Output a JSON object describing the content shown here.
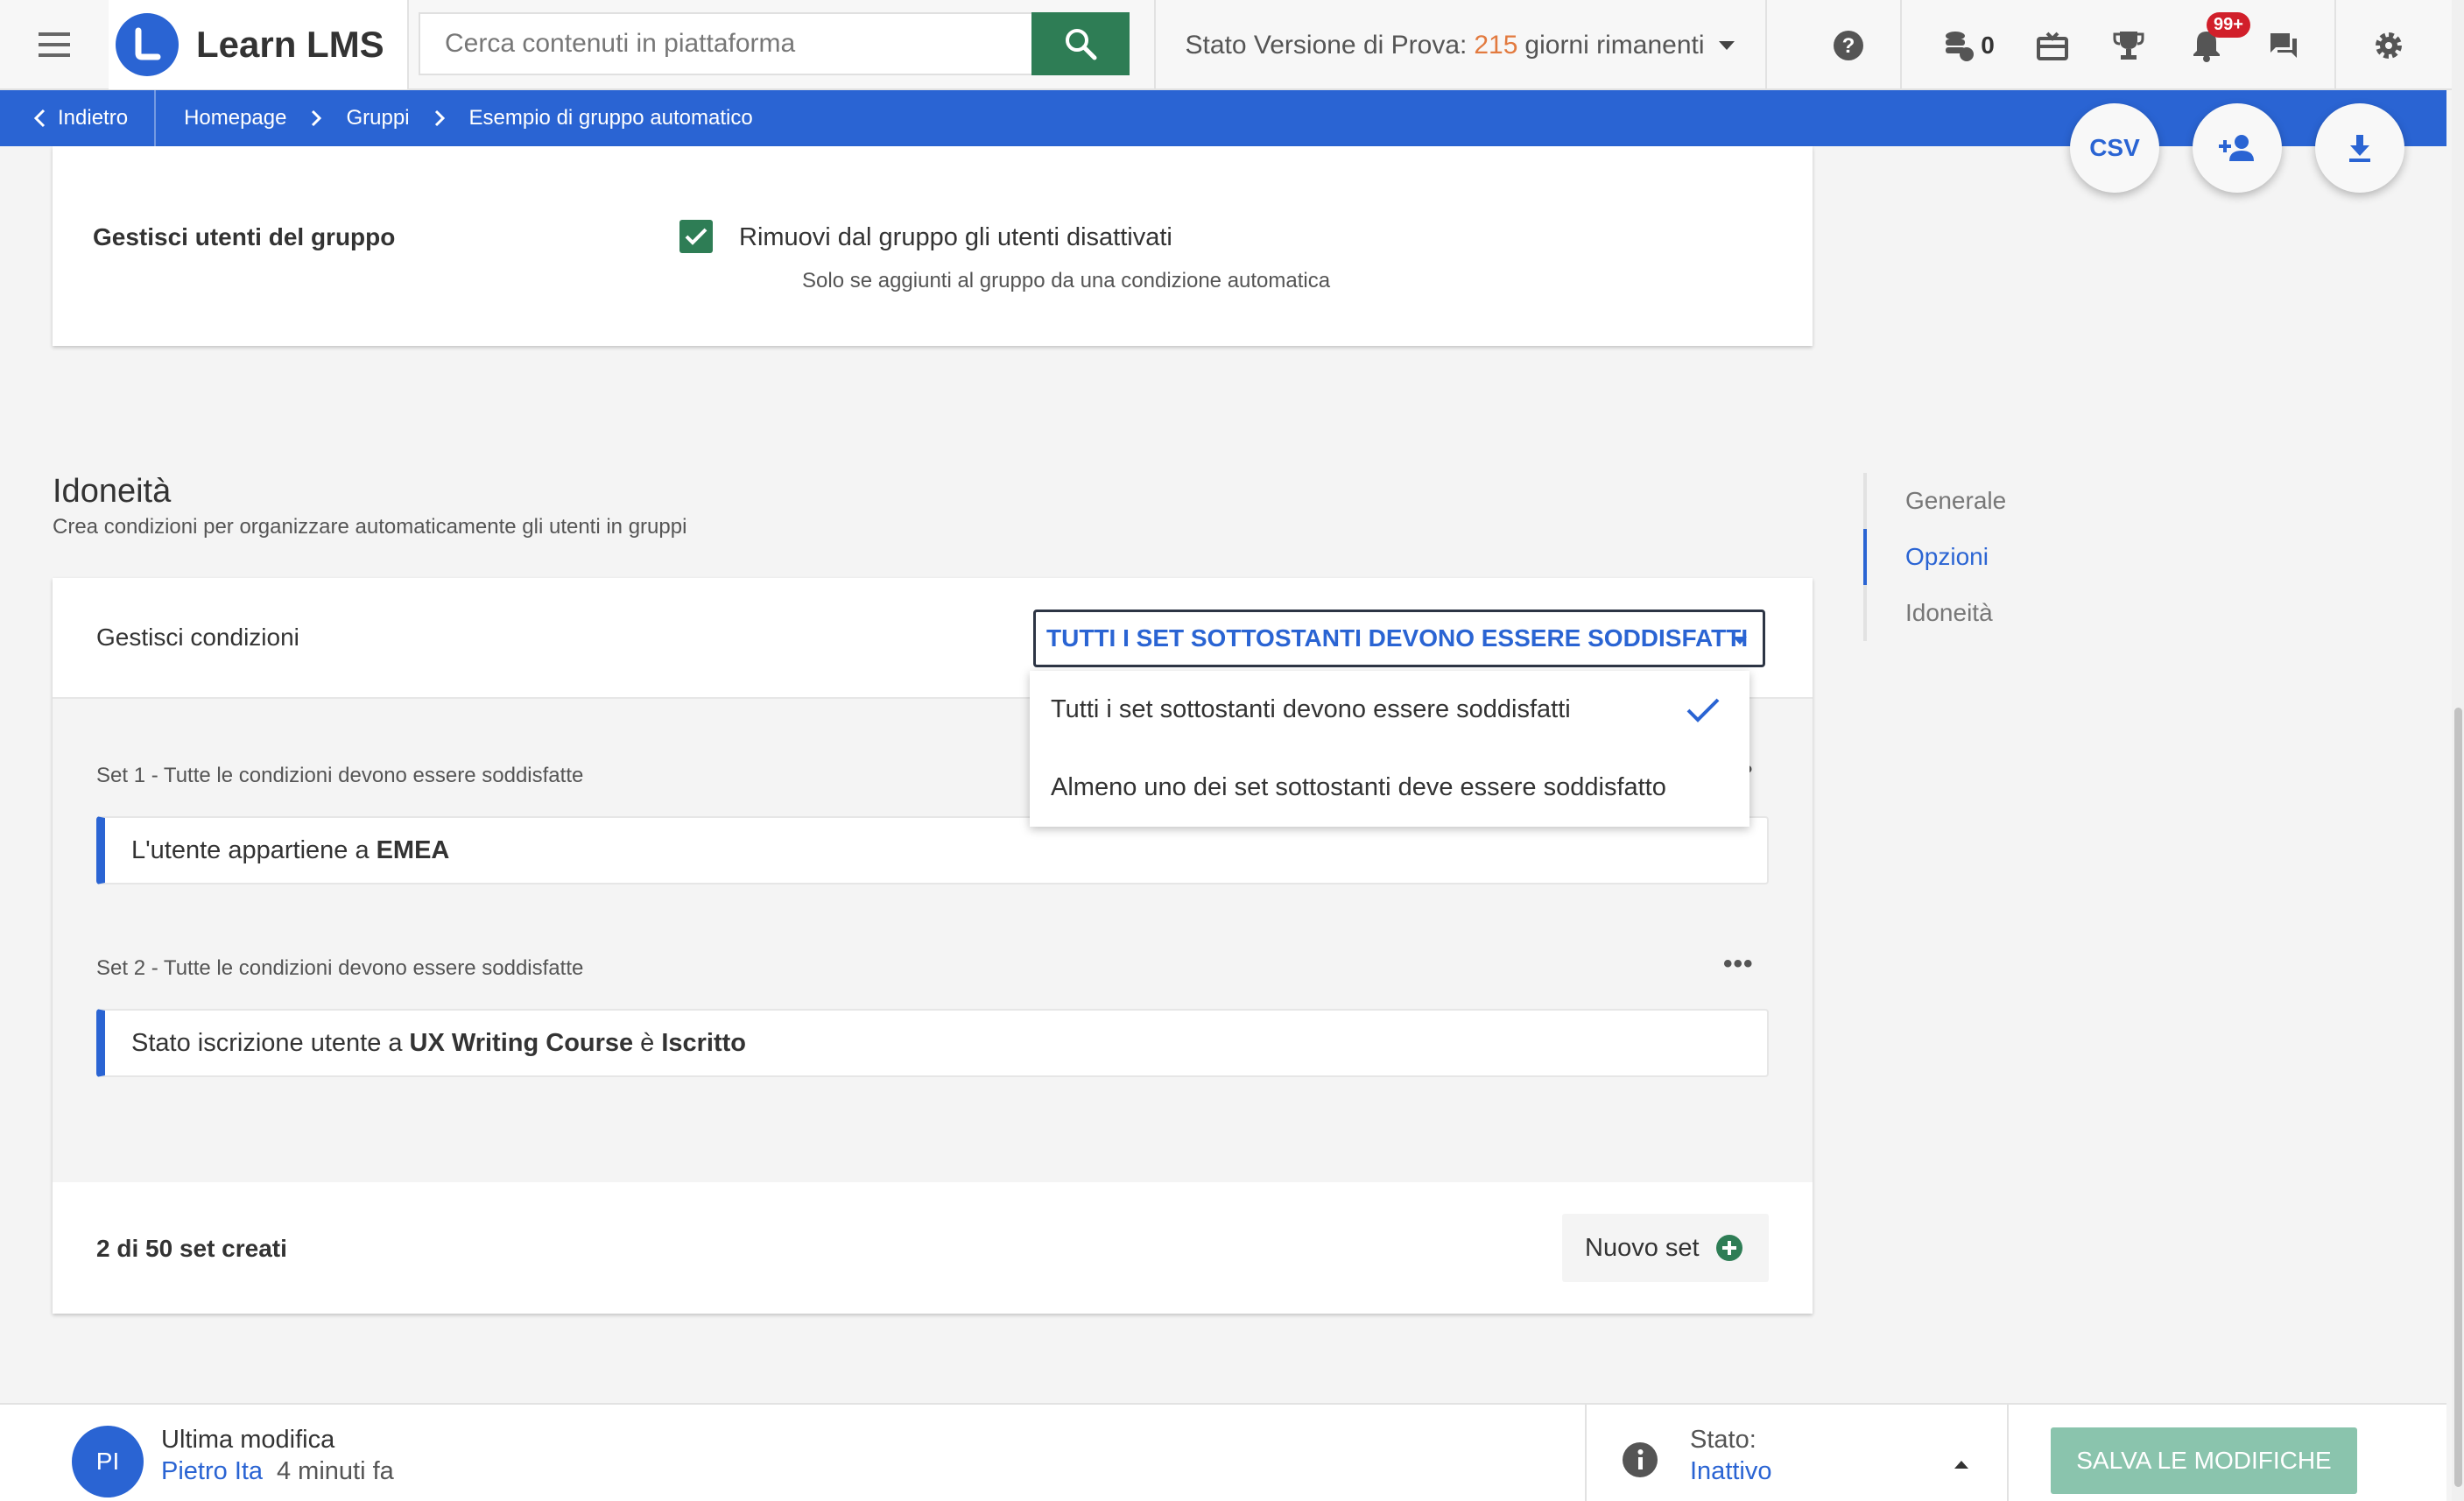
{
  "app": {
    "name": "Learn LMS"
  },
  "search": {
    "placeholder": "Cerca contenuti in piattaforma"
  },
  "trial": {
    "prefix": "Stato Versione di Prova:",
    "days": "215",
    "suffix": "giorni rimanenti"
  },
  "topbar": {
    "coins": "0",
    "notifications_badge": "99+"
  },
  "breadcrumb": {
    "back": "Indietro",
    "items": [
      "Homepage",
      "Gruppi",
      "Esempio di gruppo automatico"
    ]
  },
  "fabs": {
    "csv": "CSV"
  },
  "users_card": {
    "label": "Gestisci utenti del gruppo",
    "checkbox_label": "Rimuovi dal gruppo gli utenti disattivati",
    "hint": "Solo se aggiunti al gruppo da una condizione automatica"
  },
  "section": {
    "title": "Idoneità",
    "subtitle": "Crea condizioni per organizzare automaticamente gli utenti in gruppi"
  },
  "sidenav": {
    "items": [
      "Generale",
      "Opzioni",
      "Idoneità"
    ],
    "active": "Opzioni"
  },
  "conditions": {
    "label": "Gestisci condizioni",
    "dropdown_value": "TUTTI I SET SOTTOSTANTI DEVONO ESSERE SODDISFATTI",
    "options": [
      "Tutti i set sottostanti devono essere soddisfatti",
      "Almeno uno dei set sottostanti deve essere soddisfatto"
    ],
    "selected_option": 0
  },
  "sets": [
    {
      "label": "Set 1 - Tutte le condizioni devono essere soddisfatte",
      "condition": {
        "t1": "L'utente appartiene a",
        "b1": "EMEA"
      }
    },
    {
      "label": "Set 2 - Tutte le condizioni devono essere soddisfatte",
      "condition": {
        "t1": "Stato iscrizione utente a",
        "b1": "UX Writing Course",
        "t2": "è",
        "b2": "Iscritto"
      }
    }
  ],
  "sets_footer": {
    "count": "2 di 50 set creati",
    "new_set": "Nuovo set"
  },
  "footer": {
    "avatar_initials": "PI",
    "last_modified_label": "Ultima modifica",
    "user": "Pietro Ita",
    "time": "4 minuti fa",
    "status_label": "Stato:",
    "status_value": "Inattivo",
    "save": "SALVA LE MODIFICHE"
  },
  "colors": {
    "brand": "#2a64d3",
    "primary_green": "#2e7d55",
    "trial_days": "#e27a3f",
    "badge": "#d11f2a"
  }
}
